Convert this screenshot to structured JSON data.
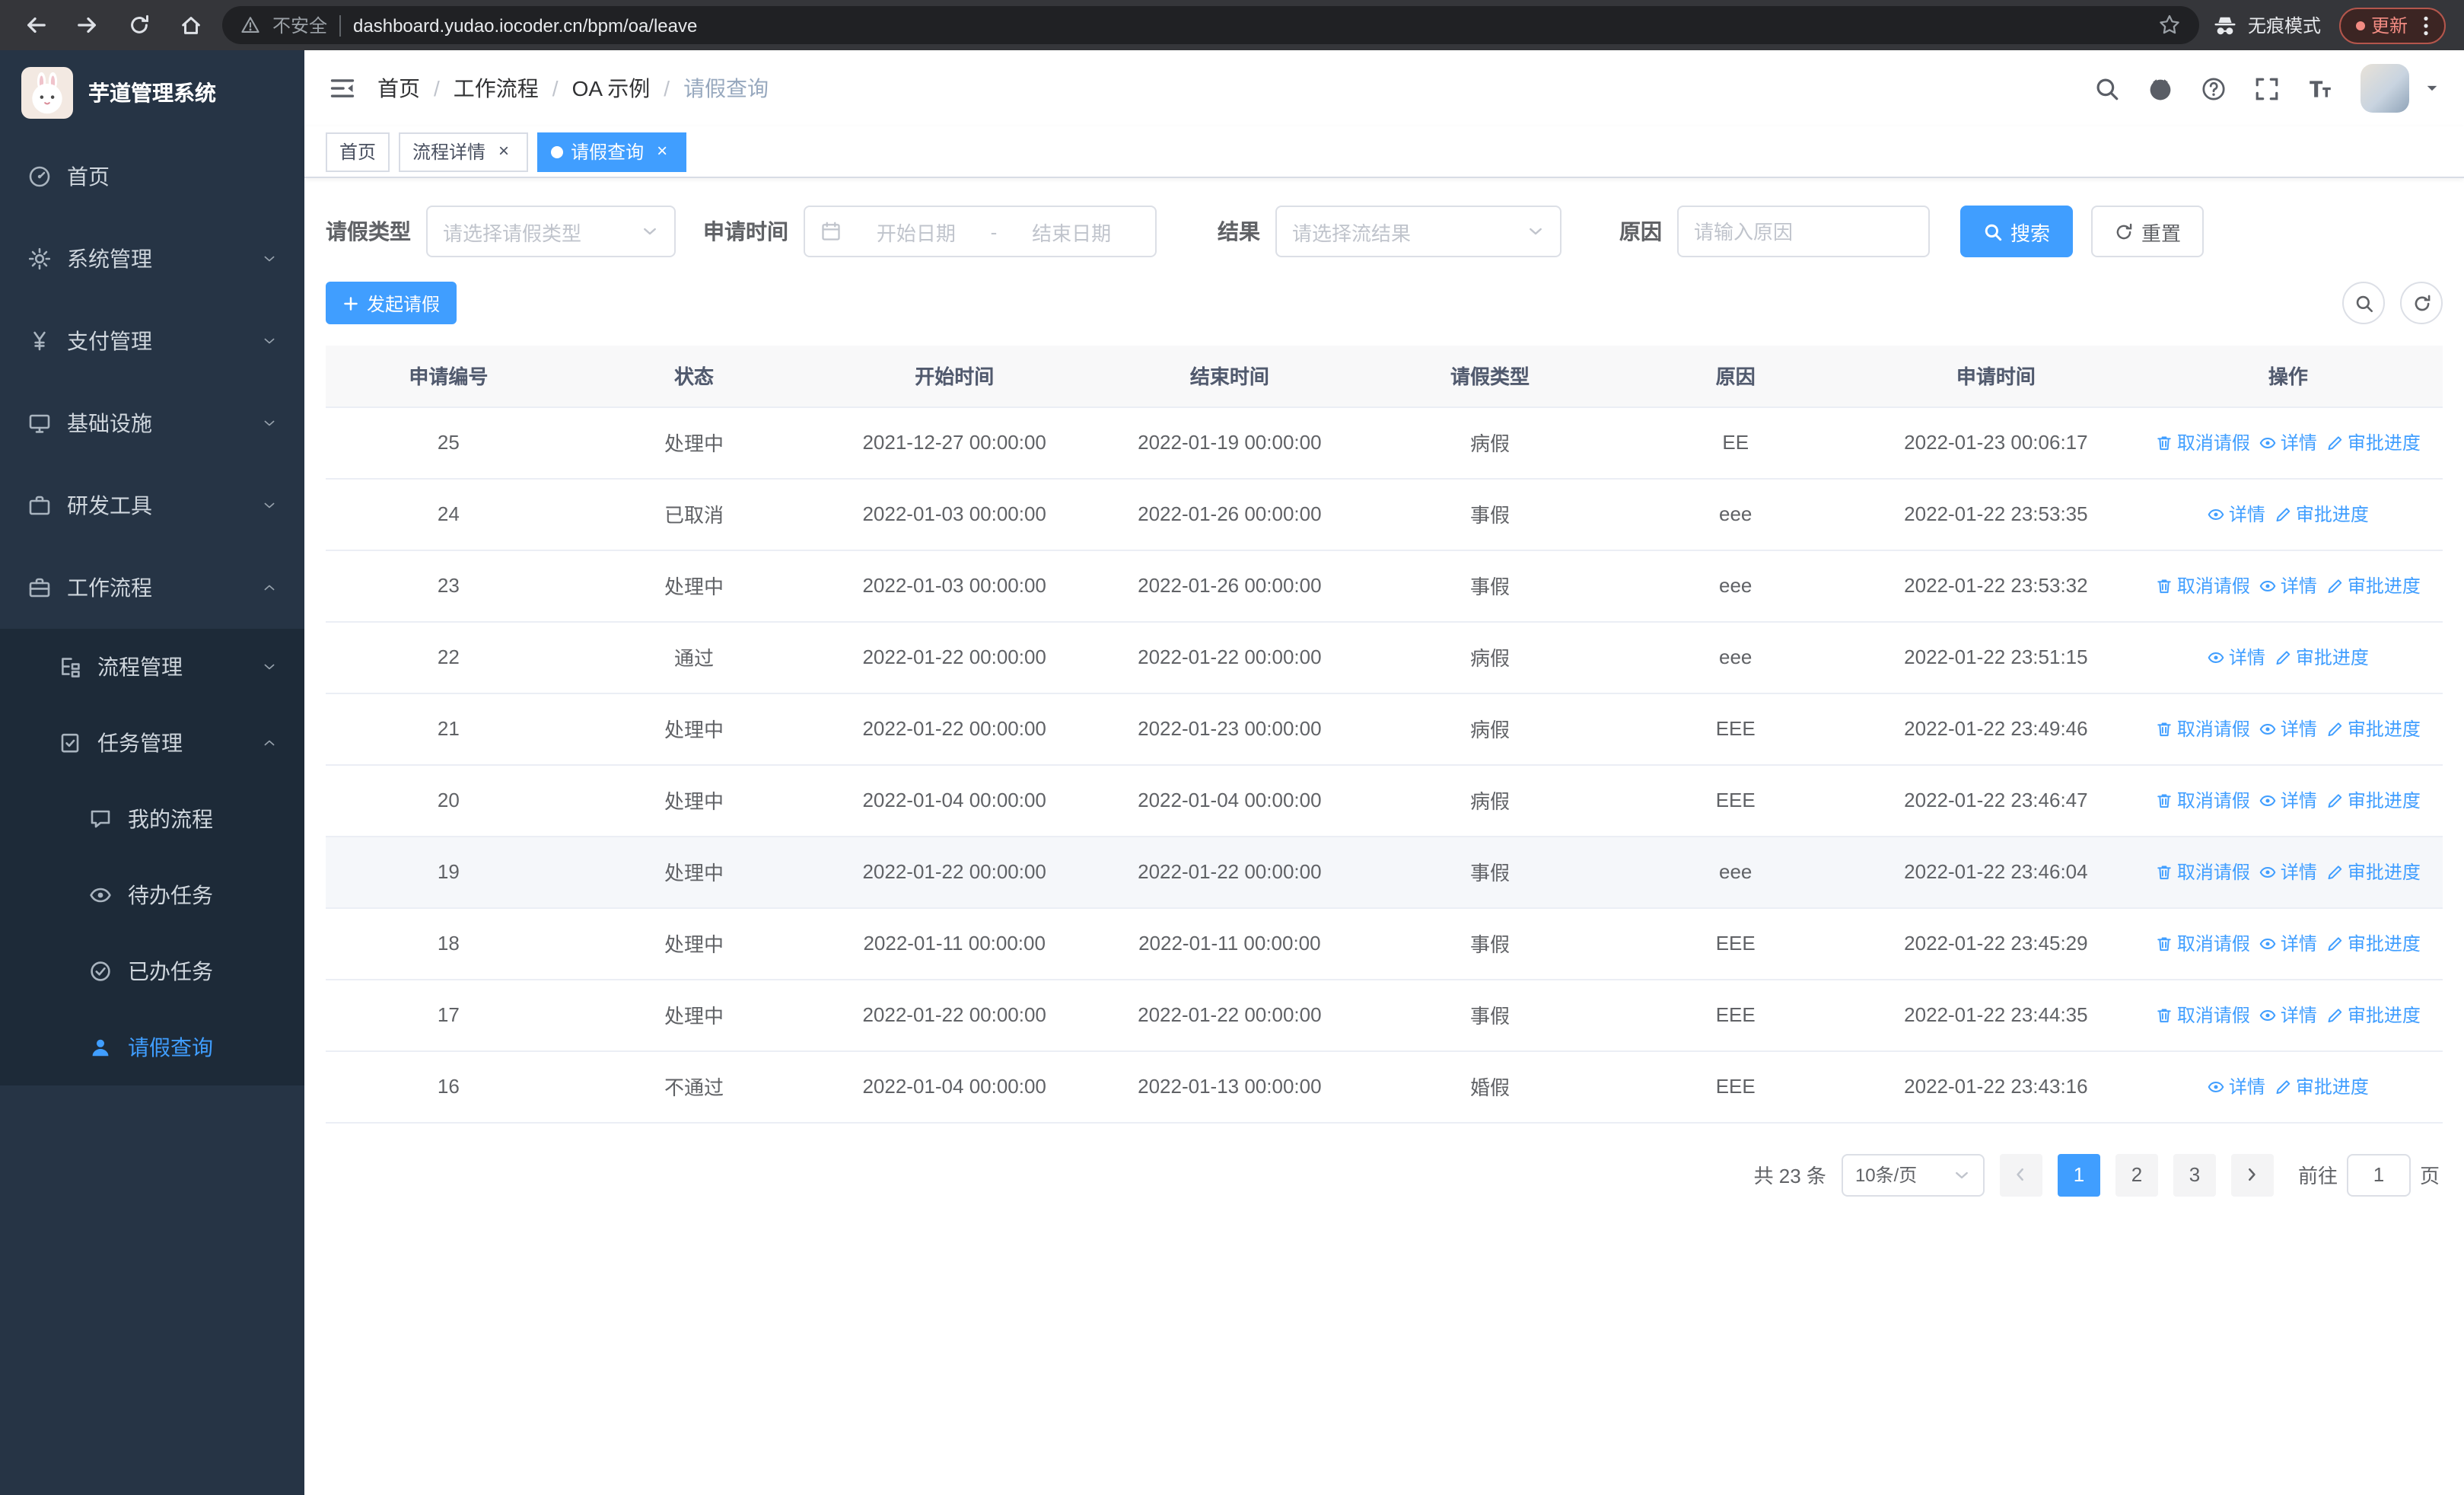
{
  "browser": {
    "security_label": "不安全",
    "url": "dashboard.yudao.iocoder.cn/bpm/oa/leave",
    "incognito_label": "无痕模式",
    "update_label": "更新",
    "nav_icons": [
      "back-arrow-icon",
      "forward-arrow-icon",
      "reload-icon",
      "home-icon",
      "bookmark-star-icon",
      "incognito-icon",
      "browser-menu-icon"
    ]
  },
  "sidebar": {
    "logo_title": "芋道管理系统",
    "menu": [
      {
        "key": "home",
        "label": "首页",
        "icon": "home-icon",
        "level": 1,
        "arrow": "none",
        "active": false
      },
      {
        "key": "system-management",
        "label": "系统管理",
        "icon": "gear-icon",
        "level": 1,
        "arrow": "down",
        "active": false
      },
      {
        "key": "payment-management",
        "label": "支付管理",
        "icon": "yen-icon",
        "level": 1,
        "arrow": "down",
        "active": false
      },
      {
        "key": "infrastructure",
        "label": "基础设施",
        "icon": "infra-icon",
        "level": 1,
        "arrow": "down",
        "active": false
      },
      {
        "key": "dev-tools",
        "label": "研发工具",
        "icon": "tool-icon",
        "level": 1,
        "arrow": "down",
        "active": false
      },
      {
        "key": "workflow",
        "label": "工作流程",
        "icon": "workflow-icon",
        "level": 1,
        "arrow": "up",
        "active": false
      },
      {
        "key": "process-management",
        "label": "流程管理",
        "icon": "process-icon",
        "level": 2,
        "arrow": "down",
        "active": false
      },
      {
        "key": "task-management",
        "label": "任务管理",
        "icon": "task-icon",
        "level": 2,
        "arrow": "up",
        "active": false
      },
      {
        "key": "my-process",
        "label": "我的流程",
        "icon": "my-process-icon",
        "level": 3,
        "arrow": "none",
        "active": false
      },
      {
        "key": "todo-tasks",
        "label": "待办任务",
        "icon": "todo-icon",
        "level": 3,
        "arrow": "none",
        "active": false
      },
      {
        "key": "done-tasks",
        "label": "已办任务",
        "icon": "done-icon",
        "level": 3,
        "arrow": "none",
        "active": false
      },
      {
        "key": "leave-query",
        "label": "请假查询",
        "icon": "leave-icon",
        "level": 3,
        "arrow": "none",
        "active": true
      }
    ]
  },
  "header": {
    "breadcrumb": [
      "首页",
      "工作流程",
      "OA 示例",
      "请假查询"
    ],
    "right_icons": [
      "search-icon",
      "github-icon",
      "help-icon",
      "fullscreen-icon",
      "font-size-icon",
      "avatar",
      "caret-down-icon"
    ]
  },
  "tabs": [
    {
      "key": "home",
      "label": "首页",
      "closable": false,
      "active": false
    },
    {
      "key": "process-detail",
      "label": "流程详情",
      "closable": true,
      "active": false
    },
    {
      "key": "leave-query",
      "label": "请假查询",
      "closable": true,
      "active": true
    }
  ],
  "filters": {
    "leave_type_label": "请假类型",
    "leave_type_placeholder": "请选择请假类型",
    "apply_time_label": "申请时间",
    "date_start_placeholder": "开始日期",
    "date_separator": "-",
    "date_end_placeholder": "结束日期",
    "result_label": "结果",
    "result_placeholder": "请选择流结果",
    "reason_label": "原因",
    "reason_placeholder": "请输入原因",
    "search_label": "搜索",
    "reset_label": "重置"
  },
  "toolbar": {
    "create_label": "发起请假"
  },
  "table": {
    "columns": [
      "申请编号",
      "状态",
      "开始时间",
      "结束时间",
      "请假类型",
      "原因",
      "申请时间",
      "操作"
    ],
    "action_labels": {
      "cancel": "取消请假",
      "detail": "详情",
      "progress": "审批进度"
    },
    "rows": [
      {
        "id": "25",
        "status": "处理中",
        "start": "2021-12-27 00:00:00",
        "end": "2022-01-19 00:00:00",
        "type": "病假",
        "reason": "EE",
        "apply_time": "2022-01-23 00:06:17",
        "actions": [
          "cancel",
          "detail",
          "progress"
        ],
        "highlighted": false
      },
      {
        "id": "24",
        "status": "已取消",
        "start": "2022-01-03 00:00:00",
        "end": "2022-01-26 00:00:00",
        "type": "事假",
        "reason": "eee",
        "apply_time": "2022-01-22 23:53:35",
        "actions": [
          "detail",
          "progress"
        ],
        "highlighted": false
      },
      {
        "id": "23",
        "status": "处理中",
        "start": "2022-01-03 00:00:00",
        "end": "2022-01-26 00:00:00",
        "type": "事假",
        "reason": "eee",
        "apply_time": "2022-01-22 23:53:32",
        "actions": [
          "cancel",
          "detail",
          "progress"
        ],
        "highlighted": false
      },
      {
        "id": "22",
        "status": "通过",
        "start": "2022-01-22 00:00:00",
        "end": "2022-01-22 00:00:00",
        "type": "病假",
        "reason": "eee",
        "apply_time": "2022-01-22 23:51:15",
        "actions": [
          "detail",
          "progress"
        ],
        "highlighted": false
      },
      {
        "id": "21",
        "status": "处理中",
        "start": "2022-01-22 00:00:00",
        "end": "2022-01-23 00:00:00",
        "type": "病假",
        "reason": "EEE",
        "apply_time": "2022-01-22 23:49:46",
        "actions": [
          "cancel",
          "detail",
          "progress"
        ],
        "highlighted": false
      },
      {
        "id": "20",
        "status": "处理中",
        "start": "2022-01-04 00:00:00",
        "end": "2022-01-04 00:00:00",
        "type": "病假",
        "reason": "EEE",
        "apply_time": "2022-01-22 23:46:47",
        "actions": [
          "cancel",
          "detail",
          "progress"
        ],
        "highlighted": false
      },
      {
        "id": "19",
        "status": "处理中",
        "start": "2022-01-22 00:00:00",
        "end": "2022-01-22 00:00:00",
        "type": "事假",
        "reason": "eee",
        "apply_time": "2022-01-22 23:46:04",
        "actions": [
          "cancel",
          "detail",
          "progress"
        ],
        "highlighted": true
      },
      {
        "id": "18",
        "status": "处理中",
        "start": "2022-01-11 00:00:00",
        "end": "2022-01-11 00:00:00",
        "type": "事假",
        "reason": "EEE",
        "apply_time": "2022-01-22 23:45:29",
        "actions": [
          "cancel",
          "detail",
          "progress"
        ],
        "highlighted": false
      },
      {
        "id": "17",
        "status": "处理中",
        "start": "2022-01-22 00:00:00",
        "end": "2022-01-22 00:00:00",
        "type": "事假",
        "reason": "EEE",
        "apply_time": "2022-01-22 23:44:35",
        "actions": [
          "cancel",
          "detail",
          "progress"
        ],
        "highlighted": false
      },
      {
        "id": "16",
        "status": "不通过",
        "start": "2022-01-04 00:00:00",
        "end": "2022-01-13 00:00:00",
        "type": "婚假",
        "reason": "EEE",
        "apply_time": "2022-01-22 23:43:16",
        "actions": [
          "detail",
          "progress"
        ],
        "highlighted": false
      }
    ]
  },
  "pagination": {
    "total_label": "共 23 条",
    "page_size_label": "10条/页",
    "pages": [
      "1",
      "2",
      "3"
    ],
    "active_page": "1",
    "goto_label": "前往",
    "goto_value": "1",
    "goto_suffix": "页"
  },
  "colors": {
    "accent": "#409eff",
    "sidebar_bg": "#263445",
    "submenu_bg": "#1d2a38",
    "browser_bar_bg": "#35363a",
    "table_header_bg": "#f8f8f9"
  }
}
